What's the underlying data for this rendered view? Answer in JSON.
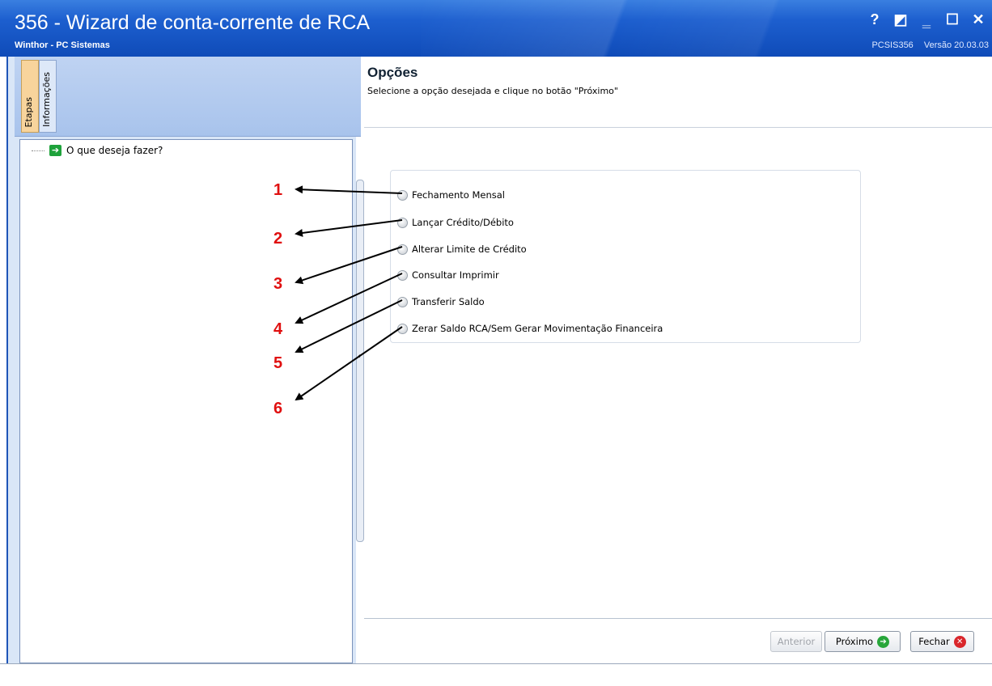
{
  "window": {
    "title": "356 - Wizard de conta-corrente de RCA",
    "subtitle": "Winthor - PC Sistemas",
    "program_code": "PCSIS356",
    "version": "Versão 20.03.03",
    "buttons": [
      "?",
      "◩",
      "‗",
      "☐",
      "✕"
    ]
  },
  "left_panel": {
    "tabs": [
      {
        "label": "Etapas",
        "active": true
      },
      {
        "label": "Informações",
        "active": false
      }
    ],
    "tree_items": [
      {
        "label": "O que deseja fazer?",
        "icon": "green-arrow-icon"
      }
    ]
  },
  "main": {
    "heading": "Opções",
    "description": "Selecione a opção desejada e clique no botão \"Próximo\"",
    "options": [
      {
        "label": "Fechamento Mensal",
        "selected": false
      },
      {
        "label": "Lançar Crédito/Débito",
        "selected": false
      },
      {
        "label": "Alterar Limite de Crédito",
        "selected": false
      },
      {
        "label": "Consultar Imprimir",
        "selected": false
      },
      {
        "label": "Transferir Saldo",
        "selected": false
      },
      {
        "label": "Zerar Saldo RCA/Sem Gerar Movimentação Financeira",
        "selected": false
      }
    ]
  },
  "footer": {
    "previous_label": "Anterior",
    "next_label": "Próximo",
    "close_label": "Fechar"
  },
  "annotations": [
    "1",
    "2",
    "3",
    "4",
    "5",
    "6"
  ],
  "colors": {
    "titlebar": "#1d5fcf",
    "annotation": "#e01010",
    "active_tab": "#f8d49c"
  }
}
